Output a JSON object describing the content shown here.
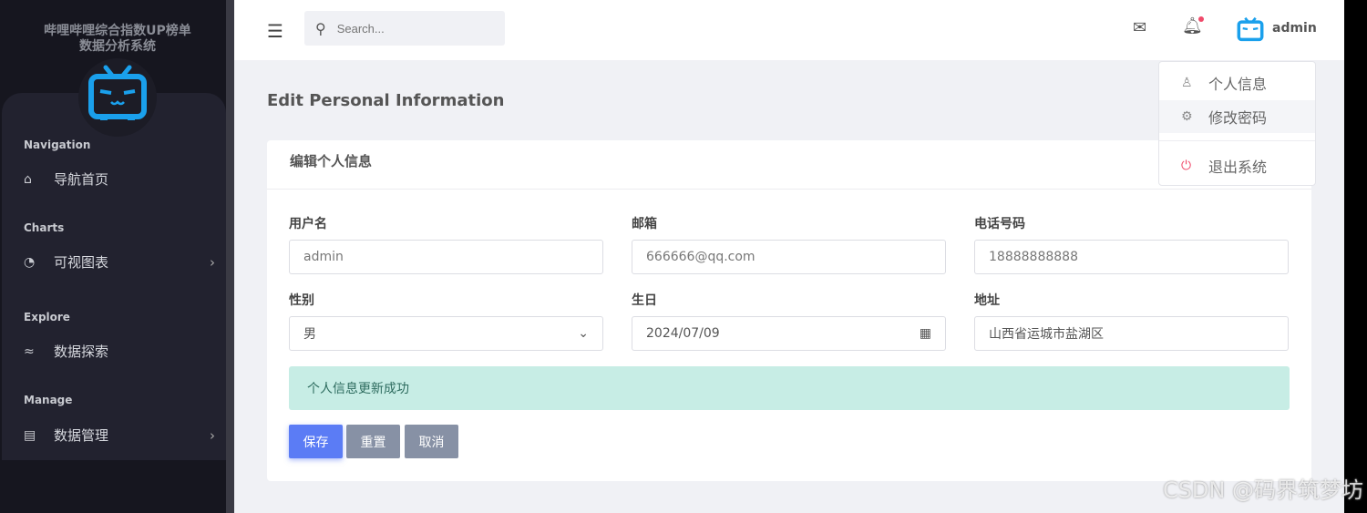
{
  "sidebar": {
    "title_line1": "哔哩哔哩综合指数UP榜单",
    "title_line2": "数据分析系统",
    "sections": [
      {
        "label": "Navigation",
        "item": "导航首页",
        "icon": "home-icon"
      },
      {
        "label": "Charts",
        "item": "可视图表",
        "icon": "pie-chart-icon"
      },
      {
        "label": "Explore",
        "item": "数据探索",
        "icon": "trend-icon"
      },
      {
        "label": "Manage",
        "item": "数据管理",
        "icon": "document-icon"
      }
    ]
  },
  "topbar": {
    "search_placeholder": "Search...",
    "username": "admin"
  },
  "dropdown": {
    "items": [
      "个人信息",
      "修改密码",
      "退出系统"
    ]
  },
  "page": {
    "title": "Edit Personal Information",
    "card_title": "编辑个人信息"
  },
  "form": {
    "username": {
      "label": "用户名",
      "value": "admin"
    },
    "email": {
      "label": "邮箱",
      "value": "666666@qq.com"
    },
    "phone": {
      "label": "电话号码",
      "value": "18888888888"
    },
    "gender": {
      "label": "性别",
      "value": "男"
    },
    "birthday": {
      "label": "生日",
      "value": "2024/07/09"
    },
    "address": {
      "label": "地址",
      "value": "山西省运城市盐湖区"
    }
  },
  "alert": "个人信息更新成功",
  "buttons": {
    "save": "保存",
    "reset": "重置",
    "cancel": "取消"
  },
  "colors": {
    "brand": "#1aa0ec",
    "save": "#5b7cf5",
    "secondary": "#8791a5",
    "alert_bg": "#c7ede5",
    "danger": "#f04a6a"
  },
  "watermark": "CSDN @码界筑梦坊"
}
